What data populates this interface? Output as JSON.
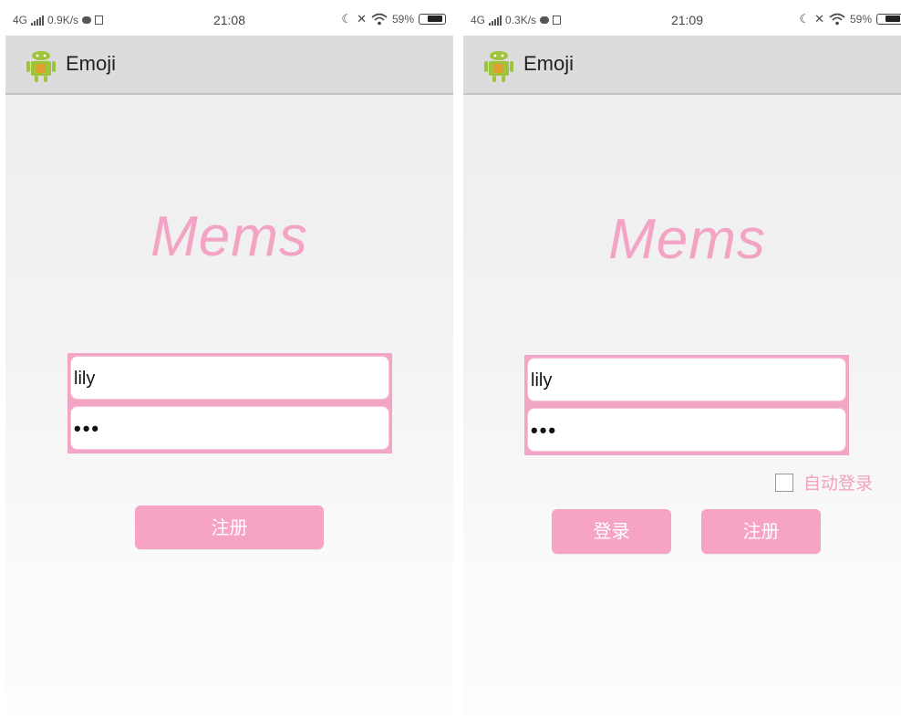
{
  "screens": [
    {
      "status": {
        "network": "4G",
        "speed": "0.9K/s",
        "time": "21:08",
        "battery": "59%"
      },
      "app_bar": {
        "title": "Emoji"
      },
      "brand": "Mems",
      "username": {
        "value": "lily"
      },
      "password": {
        "masked_value": "•••"
      },
      "buttons": {
        "register": "注册"
      }
    },
    {
      "status": {
        "network": "4G",
        "speed": "0.3K/s",
        "time": "21:09",
        "battery": "59%"
      },
      "app_bar": {
        "title": "Emoji"
      },
      "brand": "Mems",
      "username": {
        "value": "lily"
      },
      "password": {
        "masked_value": "•••"
      },
      "auto_login": {
        "label": "自动登录",
        "checked": false
      },
      "buttons": {
        "login": "登录",
        "register": "注册"
      }
    }
  ],
  "colors": {
    "accent": "#f6a3c6",
    "app_bar": "#dcdcdc",
    "brand": "#f3a4c4"
  },
  "icons": [
    "android-app-icon",
    "moon-icon",
    "mute-icon",
    "wifi-icon",
    "battery-icon"
  ]
}
